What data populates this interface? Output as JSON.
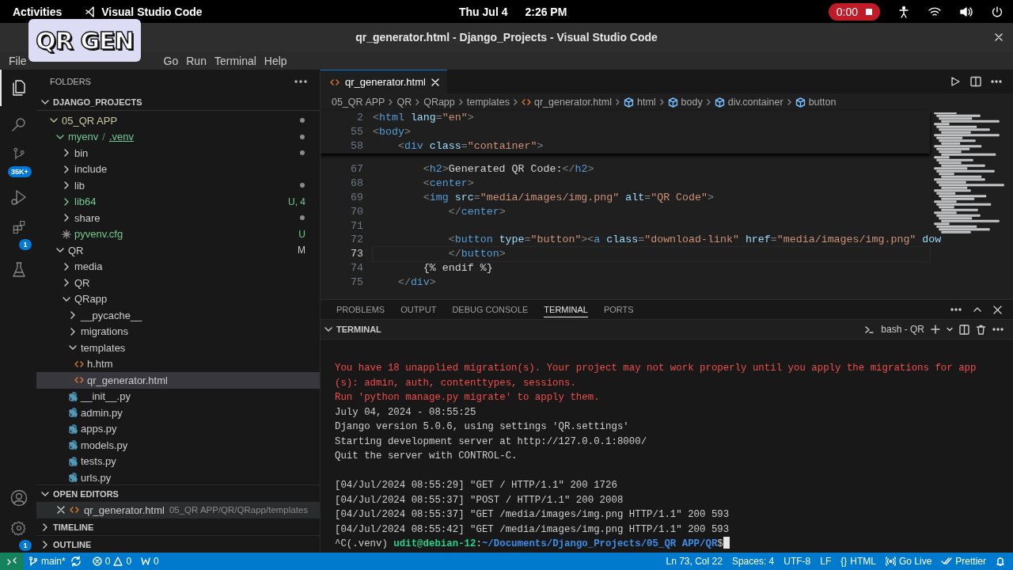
{
  "top_bar": {
    "activities": "Activities",
    "app_name": "Visual Studio Code",
    "date": "Thu Jul 4",
    "time": "2:26 PM",
    "recording": "0:00"
  },
  "overlay_caption": "QR GEN",
  "window": {
    "title": "qr_generator.html - Django_Projects - Visual Studio Code"
  },
  "menu": [
    "File",
    "Go",
    "Run",
    "Terminal",
    "Help"
  ],
  "activity_bar": [
    {
      "kind": "explorer",
      "selected": true
    },
    {
      "kind": "search",
      "selected": false
    },
    {
      "kind": "source_control",
      "selected": false,
      "badge": "35K+"
    },
    {
      "kind": "run",
      "selected": false
    },
    {
      "kind": "extensions",
      "selected": false,
      "badge": "1"
    },
    {
      "kind": "testing",
      "selected": false
    }
  ],
  "activity_bar_bottom": [
    {
      "kind": "account"
    },
    {
      "kind": "settings",
      "badge": "1"
    }
  ],
  "sidebar": {
    "title": "FOLDERS",
    "root": "DJANGO_PROJECTS",
    "tree": [
      {
        "label": "05_QR APP",
        "kind": "folder",
        "expanded": true,
        "selected": false,
        "untracked": false,
        "dot": true,
        "children": [
          {
            "label": "myenv",
            "separator": "/",
            "suffix": ".venv",
            "kind": "folder",
            "expanded": true,
            "selected": false,
            "untracked": true,
            "dot": true,
            "children": [
              {
                "label": "bin",
                "kind": "folder",
                "expanded": false,
                "selected": false,
                "untracked": false,
                "dot": true
              },
              {
                "label": "include",
                "kind": "folder",
                "expanded": false,
                "selected": false,
                "untracked": false,
                "dot": false
              },
              {
                "label": "lib",
                "kind": "folder",
                "expanded": false,
                "selected": false,
                "untracked": false,
                "dot": true
              },
              {
                "label": "lib64",
                "kind": "folder",
                "expanded": false,
                "selected": false,
                "untracked": true,
                "dot": false,
                "badge": "U, 4"
              },
              {
                "label": "share",
                "kind": "folder",
                "expanded": false,
                "selected": false,
                "untracked": false,
                "dot": true
              },
              {
                "label": "pyvenv.cfg",
                "kind": "config",
                "selected": false,
                "untracked": true,
                "dot": false,
                "badge": "U"
              }
            ]
          },
          {
            "label": "QR",
            "kind": "folder",
            "expanded": true,
            "selected": false,
            "untracked": false,
            "dot": false,
            "badge": "M",
            "children": [
              {
                "label": "media",
                "kind": "folder",
                "expanded": false,
                "selected": false,
                "untracked": false,
                "dot": false
              },
              {
                "label": "QR",
                "kind": "folder",
                "expanded": false,
                "selected": false,
                "untracked": false,
                "dot": false
              },
              {
                "label": "QRapp",
                "kind": "folder",
                "expanded": true,
                "selected": false,
                "untracked": false,
                "dot": false,
                "children": [
                  {
                    "label": "__pycache__",
                    "kind": "folder",
                    "expanded": false,
                    "selected": false,
                    "untracked": false,
                    "dot": false
                  },
                  {
                    "label": "migrations",
                    "kind": "folder",
                    "expanded": false,
                    "selected": false,
                    "untracked": false,
                    "dot": false
                  },
                  {
                    "label": "templates",
                    "kind": "folder",
                    "expanded": true,
                    "selected": false,
                    "untracked": false,
                    "dot": false,
                    "children": [
                      {
                        "label": "h.htm",
                        "kind": "html",
                        "selected": false,
                        "untracked": false,
                        "dot": false
                      },
                      {
                        "label": "qr_generator.html",
                        "kind": "html",
                        "selected": true,
                        "untracked": false,
                        "dot": false
                      }
                    ]
                  },
                  {
                    "label": "__init__.py",
                    "kind": "python",
                    "selected": false,
                    "untracked": false,
                    "dot": false
                  },
                  {
                    "label": "admin.py",
                    "kind": "python",
                    "selected": false,
                    "untracked": false,
                    "dot": false
                  },
                  {
                    "label": "apps.py",
                    "kind": "python",
                    "selected": false,
                    "untracked": false,
                    "dot": false
                  },
                  {
                    "label": "models.py",
                    "kind": "python",
                    "selected": false,
                    "untracked": false,
                    "dot": false
                  },
                  {
                    "label": "tests.py",
                    "kind": "python",
                    "selected": false,
                    "untracked": false,
                    "dot": false
                  },
                  {
                    "label": "urls.py",
                    "kind": "python",
                    "selected": false,
                    "untracked": false,
                    "dot": false
                  }
                ]
              }
            ]
          }
        ]
      }
    ],
    "sections": [
      {
        "title": "OPEN EDITORS",
        "expanded": true,
        "items": [
          {
            "name": "qr_generator.html",
            "path": "05_QR APP/QR/QRapp/templates"
          }
        ]
      },
      {
        "title": "TIMELINE",
        "expanded": false
      },
      {
        "title": "OUTLINE",
        "expanded": false
      }
    ]
  },
  "editor": {
    "tabs": [
      {
        "label": "qr_generator.html",
        "selected": true
      }
    ],
    "breadcrumbs": [
      {
        "kind": "folder",
        "label": "05_QR APP"
      },
      {
        "kind": "folder",
        "label": "QR"
      },
      {
        "kind": "folder",
        "label": "QRapp"
      },
      {
        "kind": "folder",
        "label": "templates"
      },
      {
        "kind": "file",
        "label": "qr_generator.html"
      },
      {
        "kind": "symbol",
        "label": "html"
      },
      {
        "kind": "symbol",
        "label": "body"
      },
      {
        "kind": "symbol",
        "label": "div.container"
      },
      {
        "kind": "symbol",
        "label": "button"
      }
    ],
    "sticky_lines": [
      {
        "number": "2",
        "text": "<html lang=\"en\">"
      },
      {
        "number": "55",
        "text": "<body>"
      },
      {
        "number": "58",
        "text": "    <div class=\"container\">"
      }
    ],
    "lines": [
      {
        "number": "67",
        "current": false,
        "text": "        <h2>Generated QR Code:</h2>"
      },
      {
        "number": "68",
        "current": false,
        "text": "        <center>"
      },
      {
        "number": "69",
        "current": false,
        "text": "        <img src=\"media/images/img.png\" alt=\"QR Code\">"
      },
      {
        "number": "70",
        "current": false,
        "text": "            </center>"
      },
      {
        "number": "71",
        "current": false
      },
      {
        "number": "72",
        "current": false,
        "text": "            <button type=\"button\"><a class=\"download-link\" href=\"media/images/img.png\" dow"
      },
      {
        "number": "73",
        "current": true,
        "text": "            </button>"
      },
      {
        "number": "74",
        "current": false,
        "text": "        {% endif %}"
      },
      {
        "number": "75",
        "current": false,
        "text": "    </div>"
      }
    ]
  },
  "panel": {
    "tabs": [
      {
        "label": "PROBLEMS",
        "selected": false
      },
      {
        "label": "OUTPUT",
        "selected": false
      },
      {
        "label": "DEBUG CONSOLE",
        "selected": false
      },
      {
        "label": "TERMINAL",
        "selected": true
      },
      {
        "label": "PORTS",
        "selected": false
      }
    ],
    "terminal_title": "TERMINAL",
    "shell": "bash - QR",
    "lines": [
      {
        "kind": "error",
        "text": "You have 18 unapplied migration(s). Your project may not work properly until you apply the migrations for app"
      },
      {
        "kind": "error",
        "text": "(s): admin, auth, contenttypes, sessions."
      },
      {
        "kind": "error",
        "text": "Run 'python manage.py migrate' to apply them."
      },
      {
        "kind": "normal",
        "text": "July 04, 2024 - 08:55:25"
      },
      {
        "kind": "normal",
        "text": "Django version 5.0.6, using settings 'QR.settings'"
      },
      {
        "kind": "normal",
        "text": "Starting development server at http://127.0.0.1:8000/"
      },
      {
        "kind": "normal",
        "text": "Quit the server with CONTROL-C."
      },
      {
        "kind": "blank"
      },
      {
        "kind": "normal",
        "text": "[04/Jul/2024 08:55:29] \"GET / HTTP/1.1\" 200 1726"
      },
      {
        "kind": "normal",
        "text": "[04/Jul/2024 08:55:37] \"POST / HTTP/1.1\" 200 2008"
      },
      {
        "kind": "normal",
        "text": "[04/Jul/2024 08:55:37] \"GET /media/images/img.png HTTP/1.1\" 200 593"
      },
      {
        "kind": "normal",
        "text": "[04/Jul/2024 08:55:42] \"GET /media/images/img.png HTTP/1.1\" 200 593"
      },
      {
        "kind": "prompt",
        "prefix": "^C(.venv) ",
        "user": "udit@debian-12",
        "sep": ":",
        "path": "~/Documents/Django_Projects/05_QR APP/QR",
        "symbol": "$"
      }
    ]
  },
  "status_bar": {
    "branch": "main*",
    "errors": "0",
    "warnings": "0",
    "ports": "0",
    "position": "Ln 73, Col 22",
    "indent": "Spaces: 4",
    "encoding": "UTF-8",
    "eol": "LF",
    "language_icon": "{}",
    "language": "HTML",
    "live": "Go Live",
    "formatter": "Prettier"
  }
}
